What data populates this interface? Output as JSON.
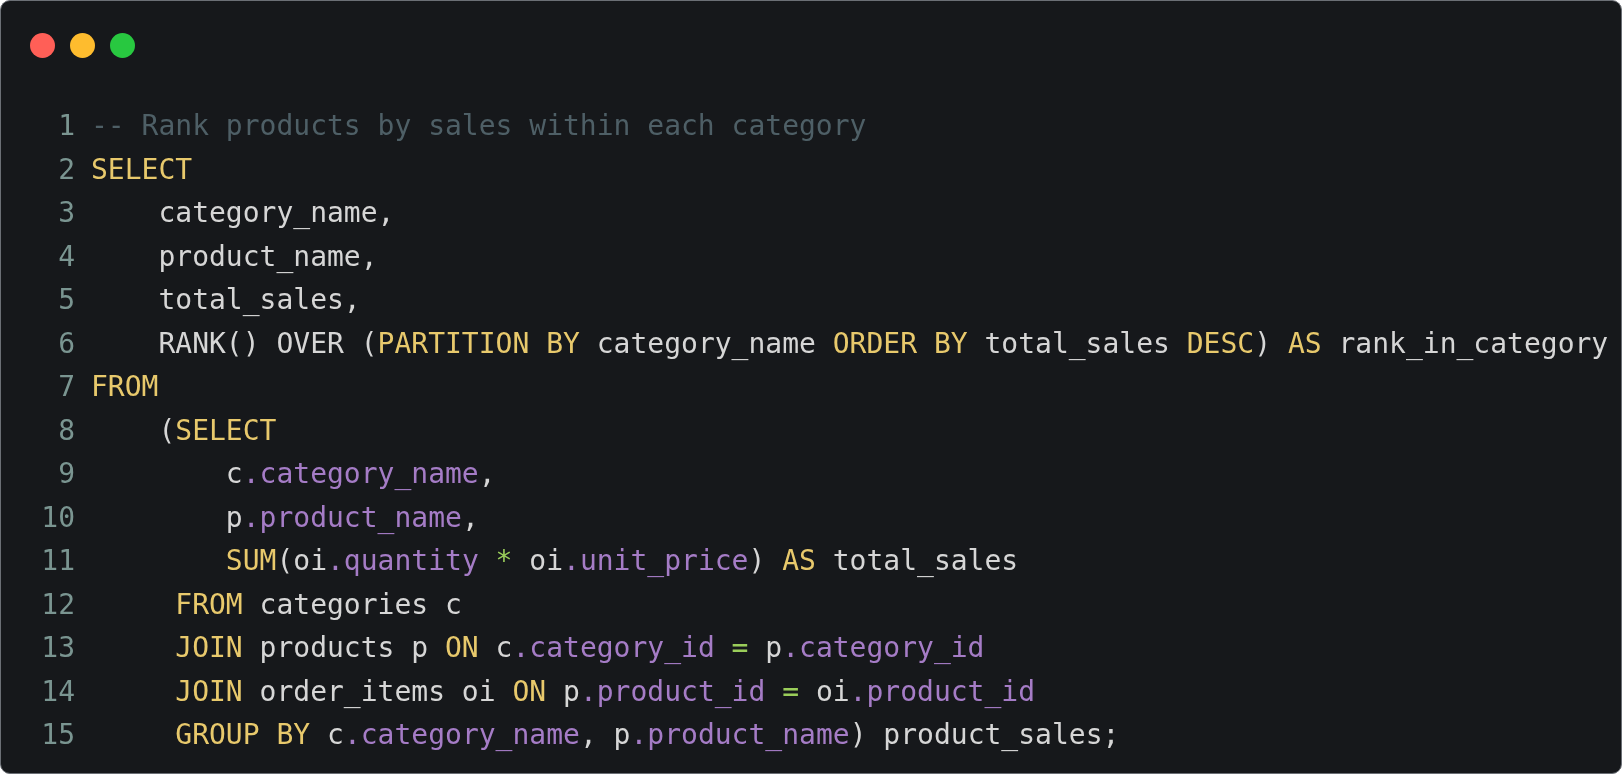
{
  "window_controls": [
    {
      "color": "#ff5f57"
    },
    {
      "color": "#febc2e"
    },
    {
      "color": "#28c840"
    }
  ],
  "lines": [
    {
      "number": "1",
      "tokens": [
        {
          "kind": "comment",
          "text": "-- Rank products by sales within each category"
        }
      ]
    },
    {
      "number": "2",
      "tokens": [
        {
          "kind": "keyword",
          "text": "SELECT"
        }
      ]
    },
    {
      "number": "3",
      "tokens": [
        {
          "kind": "plain",
          "text": "    category_name,"
        }
      ]
    },
    {
      "number": "4",
      "tokens": [
        {
          "kind": "plain",
          "text": "    product_name,"
        }
      ]
    },
    {
      "number": "5",
      "tokens": [
        {
          "kind": "plain",
          "text": "    total_sales,"
        }
      ]
    },
    {
      "number": "6",
      "tokens": [
        {
          "kind": "plain",
          "text": "    RANK() OVER ("
        },
        {
          "kind": "keyword",
          "text": "PARTITION BY"
        },
        {
          "kind": "plain",
          "text": " category_name "
        },
        {
          "kind": "keyword",
          "text": "ORDER BY"
        },
        {
          "kind": "plain",
          "text": " total_sales "
        },
        {
          "kind": "keyword",
          "text": "DESC"
        },
        {
          "kind": "plain",
          "text": ") "
        },
        {
          "kind": "keyword",
          "text": "AS"
        },
        {
          "kind": "plain",
          "text": " rank_in_category"
        }
      ]
    },
    {
      "number": "7",
      "tokens": [
        {
          "kind": "keyword",
          "text": "FROM"
        }
      ]
    },
    {
      "number": "8",
      "tokens": [
        {
          "kind": "plain",
          "text": "    ("
        },
        {
          "kind": "keyword",
          "text": "SELECT"
        }
      ]
    },
    {
      "number": "9",
      "tokens": [
        {
          "kind": "plain",
          "text": "        c"
        },
        {
          "kind": "property",
          "text": ".category_name"
        },
        {
          "kind": "plain",
          "text": ","
        }
      ]
    },
    {
      "number": "10",
      "tokens": [
        {
          "kind": "plain",
          "text": "        p"
        },
        {
          "kind": "property",
          "text": ".product_name"
        },
        {
          "kind": "plain",
          "text": ","
        }
      ]
    },
    {
      "number": "11",
      "tokens": [
        {
          "kind": "keyword",
          "text": "        SUM"
        },
        {
          "kind": "plain",
          "text": "(oi"
        },
        {
          "kind": "property",
          "text": ".quantity"
        },
        {
          "kind": "operator",
          "text": " *"
        },
        {
          "kind": "plain",
          "text": " oi"
        },
        {
          "kind": "property",
          "text": ".unit_price"
        },
        {
          "kind": "plain",
          "text": ") "
        },
        {
          "kind": "keyword",
          "text": "AS"
        },
        {
          "kind": "plain",
          "text": " total_sales"
        }
      ]
    },
    {
      "number": "12",
      "tokens": [
        {
          "kind": "keyword",
          "text": "     FROM"
        },
        {
          "kind": "plain",
          "text": " categories c"
        }
      ]
    },
    {
      "number": "13",
      "tokens": [
        {
          "kind": "keyword",
          "text": "     JOIN"
        },
        {
          "kind": "plain",
          "text": " products p "
        },
        {
          "kind": "keyword",
          "text": "ON"
        },
        {
          "kind": "plain",
          "text": " c"
        },
        {
          "kind": "property",
          "text": ".category_id"
        },
        {
          "kind": "operator",
          "text": " ="
        },
        {
          "kind": "plain",
          "text": " p"
        },
        {
          "kind": "property",
          "text": ".category_id"
        }
      ]
    },
    {
      "number": "14",
      "tokens": [
        {
          "kind": "keyword",
          "text": "     JOIN"
        },
        {
          "kind": "plain",
          "text": " order_items oi "
        },
        {
          "kind": "keyword",
          "text": "ON"
        },
        {
          "kind": "plain",
          "text": " p"
        },
        {
          "kind": "property",
          "text": ".product_id"
        },
        {
          "kind": "operator",
          "text": " ="
        },
        {
          "kind": "plain",
          "text": " oi"
        },
        {
          "kind": "property",
          "text": ".product_id"
        }
      ]
    },
    {
      "number": "15",
      "tokens": [
        {
          "kind": "keyword",
          "text": "     GROUP BY"
        },
        {
          "kind": "plain",
          "text": " c"
        },
        {
          "kind": "property",
          "text": ".category_name"
        },
        {
          "kind": "plain",
          "text": ", p"
        },
        {
          "kind": "property",
          "text": ".product_name"
        },
        {
          "kind": "plain",
          "text": ") product_sales;"
        }
      ]
    }
  ]
}
